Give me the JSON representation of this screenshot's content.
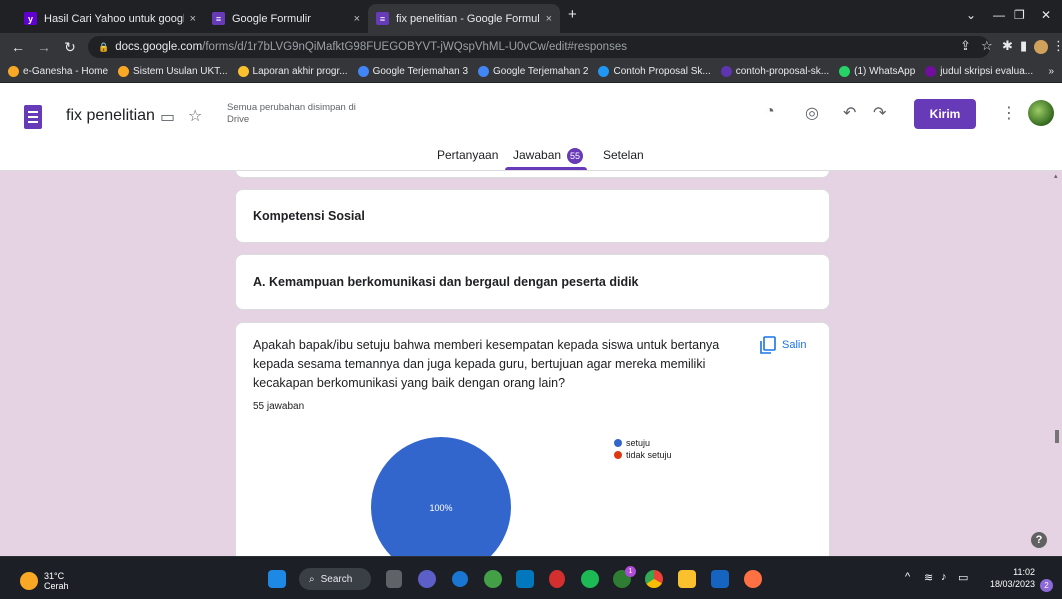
{
  "browser": {
    "tabs": [
      {
        "title": "Hasil Cari Yahoo untuk google fo",
        "close": "×",
        "icon": "yahoo-icon"
      },
      {
        "title": "Google Formulir",
        "close": "×",
        "icon": "google-forms-icon"
      },
      {
        "title": "fix penelitian - Google Formulir",
        "close": "×",
        "icon": "google-forms-icon"
      }
    ],
    "new_tab": "+",
    "url_host": "docs.google.com",
    "url_path": "/forms/d/1r7bLVG9nQiMafktG98FUEGOBYVT-jWQspVhML-U0vCw/edit#responses",
    "bookmarks": [
      {
        "label": "e-Ganesha - Home",
        "color": "#f9a825"
      },
      {
        "label": "Sistem Usulan UKT...",
        "color": "#f9a825"
      },
      {
        "label": "Laporan akhir progr...",
        "color": "#fbc02d"
      },
      {
        "label": "Google Terjemahan 3",
        "color": "#4285f4"
      },
      {
        "label": "Google Terjemahan 2",
        "color": "#4285f4"
      },
      {
        "label": "Contoh Proposal Sk...",
        "color": "#2196f3"
      },
      {
        "label": "contoh-proposal-sk...",
        "color": "#5e35b1"
      },
      {
        "label": "(1) WhatsApp",
        "color": "#25d366"
      },
      {
        "label": "judul skripsi evalua...",
        "color": "#720e9e"
      }
    ],
    "bookmarks_more": "»"
  },
  "form": {
    "title": "fix penelitian",
    "save_status": "Semua perubahan disimpan di Drive",
    "send_label": "Kirim",
    "tabs": {
      "questions": "Pertanyaan",
      "responses": "Jawaban",
      "responses_count": "55",
      "settings": "Setelan"
    }
  },
  "content": {
    "section_title": "Kompetensi Sosial",
    "subsection_title": "A.  Kemampuan berkomunikasi dan bergaul dengan peserta didik",
    "question": "Apakah bapak/ibu setuju bahwa memberi kesempatan kepada siswa untuk bertanya kepada sesama temannya dan juga kepada guru, bertujuan agar mereka memiliki kecakapan berkomunikasi yang baik dengan orang lain?",
    "response_count": "55 jawaban",
    "copy_label": "Salin",
    "help": "?"
  },
  "chart_data": {
    "type": "pie",
    "categories": [
      "setuju",
      "tidak setuju"
    ],
    "values": [
      100,
      0
    ],
    "data_label": "100%",
    "colors": [
      "#3366cc",
      "#dc3912"
    ],
    "legend_position": "right"
  },
  "taskbar": {
    "temperature": "31°C",
    "weather": "Cerah",
    "search_label": "Search",
    "time": "11:02",
    "date": "18/03/2023",
    "notification_count": "2",
    "whatsapp_badge": "1"
  }
}
